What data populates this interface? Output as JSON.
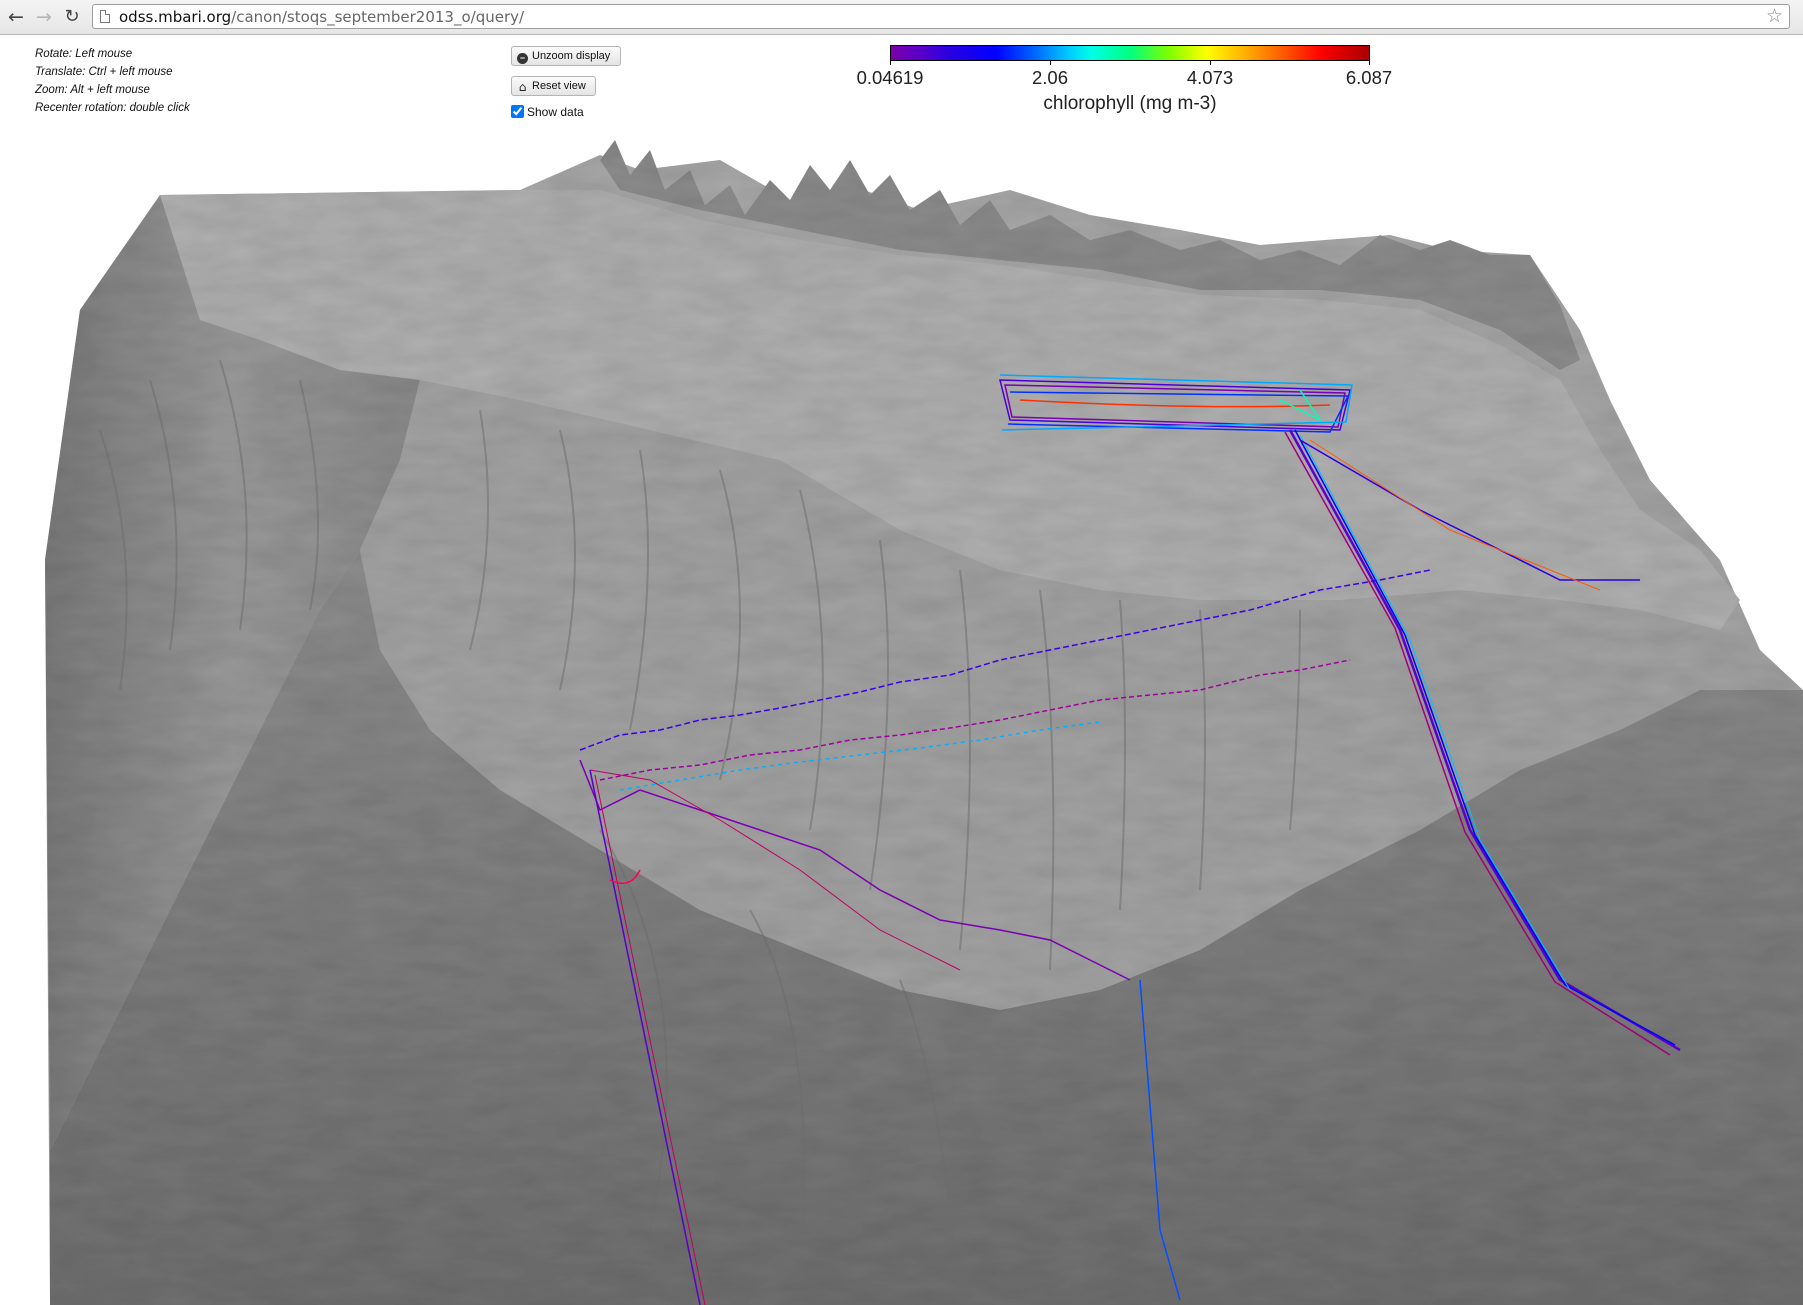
{
  "browser": {
    "url_host": "odss.mbari.org",
    "url_path": "/canon/stoqs_september2013_o/query/"
  },
  "help": {
    "lines": [
      "Rotate: Left mouse",
      "Translate: Ctrl + left mouse",
      "Zoom: Alt + left mouse",
      "Recenter rotation: double click"
    ]
  },
  "controls": {
    "unzoom_label": "Unzoom display",
    "reset_view_label": "Reset view",
    "show_data_label": "Show data",
    "show_data_checked": true
  },
  "colorbar": {
    "min": 0.04619,
    "max": 6.087,
    "tick_labels": [
      "0.04619",
      "2.06",
      "4.073",
      "6.087"
    ],
    "variable_label": "chlorophyll (mg m-3)",
    "colormap": "jet-like (purple → blue → cyan → green → yellow → red → dark red)"
  },
  "scene": {
    "type": "3d-bathymetry-terrain",
    "terrain_color": "#9a9a9a",
    "tracks_colored_by": "chlorophyll"
  },
  "icons": {
    "back": "back-arrow-icon",
    "forward": "forward-arrow-icon",
    "reload": "reload-icon",
    "page": "page-icon",
    "bookmark": "star-icon",
    "unzoom": "unzoom-icon",
    "reset": "home-icon"
  }
}
